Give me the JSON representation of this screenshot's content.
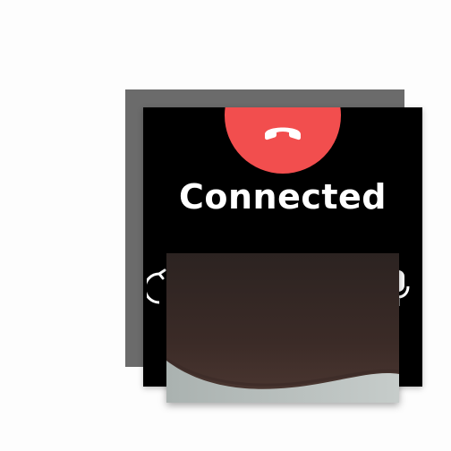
{
  "call": {
    "status": "Connected",
    "end_call_color": "#f24e4e"
  },
  "icons": {
    "end_call": "phone-hangup-icon",
    "switch_camera": "camera-switch-icon",
    "mute": "microphone-icon"
  }
}
